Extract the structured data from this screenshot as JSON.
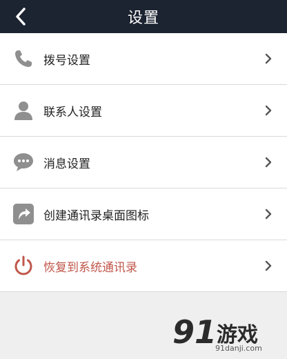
{
  "header": {
    "title": "设置"
  },
  "items": [
    {
      "label": "拨号设置",
      "icon": "phone-icon"
    },
    {
      "label": "联系人设置",
      "icon": "person-icon"
    },
    {
      "label": "消息设置",
      "icon": "chat-bubble-icon"
    },
    {
      "label": "创建通讯录桌面图标",
      "icon": "share-arrow-icon"
    },
    {
      "label": "恢复到系统通讯录",
      "icon": "power-icon",
      "color": "#c0564a"
    }
  ],
  "watermark": {
    "number": "91",
    "text": "游戏",
    "url": "91danji.com"
  },
  "colors": {
    "header_bg": "#1c2331",
    "danger": "#c0564a",
    "icon_gray": "#8f8f8f"
  }
}
